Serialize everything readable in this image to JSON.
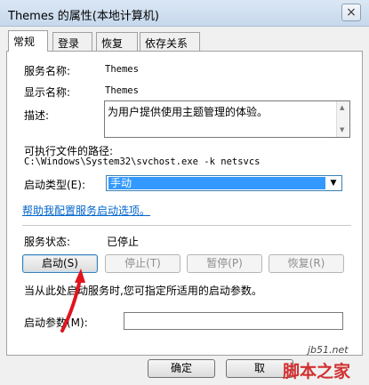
{
  "window": {
    "title": "Themes 的属性(本地计算机)",
    "close_glyph": "×"
  },
  "tabs": [
    {
      "label": "常规",
      "active": true
    },
    {
      "label": "登录",
      "mnemonic": ""
    },
    {
      "label": "恢复"
    },
    {
      "label": "依存关系"
    }
  ],
  "general": {
    "service_name_label": "服务名称:",
    "service_name_value": "Themes",
    "display_name_label": "显示名称:",
    "display_name_value": "Themes",
    "description_label": "描述:",
    "description_value": "为用户提供使用主题管理的体验。",
    "exe_path_label": "可执行文件的路径:",
    "exe_path_value": "C:\\Windows\\System32\\svchost.exe -k netsvcs",
    "startup_type_label": "启动类型(E):",
    "startup_type_value": "手动",
    "help_link": "帮助我配置服务启动选项。",
    "service_status_label": "服务状态:",
    "service_status_value": "已停止",
    "start_button": "启动(S)",
    "stop_button": "停止(T)",
    "pause_button": "暂停(P)",
    "resume_button": "恢复(R)",
    "hint_text": "当从此处启动服务时,您可指定所适用的启动参数。",
    "start_params_label": "启动参数(M):",
    "start_params_value": ""
  },
  "footer": {
    "ok_button": "确定",
    "cancel_button": "取"
  },
  "watermark": {
    "site": "jb51.net",
    "text": "脚本之家"
  },
  "colors": {
    "accent": "#3399ff",
    "link": "#0066cc",
    "arrow": "#e0141e"
  },
  "icons": {
    "close": "close-icon",
    "dropdown": "chevron-down-icon",
    "scroll_up": "scroll-up-icon",
    "scroll_down": "scroll-down-icon"
  }
}
